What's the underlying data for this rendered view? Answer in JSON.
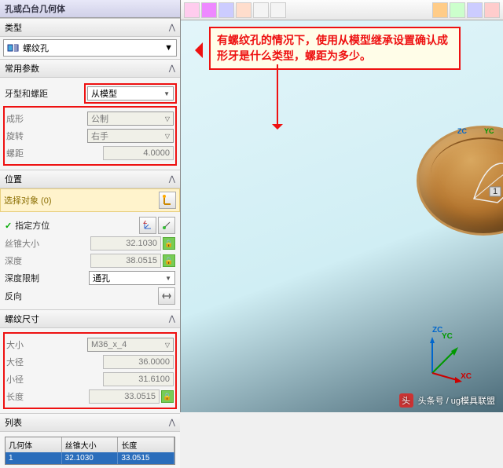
{
  "window_title": "孔或凸台几何体",
  "type_section": {
    "label": "类型",
    "value": "螺纹孔"
  },
  "params_section": {
    "label": "常用参数",
    "thread_type_label": "牙型和螺距",
    "thread_type_value": "从模型",
    "form_label": "成形",
    "form_value": "公制",
    "rotation_label": "旋转",
    "rotation_value": "右手",
    "pitch_label": "螺距",
    "pitch_value": "4.0000"
  },
  "position_section": {
    "label": "位置",
    "select_label": "选择对象 (0)",
    "orient_label": "指定方位",
    "taper_label": "丝锥大小",
    "taper_value": "32.1030",
    "depth_label": "深度",
    "depth_value": "38.0515",
    "depth_limit_label": "深度限制",
    "depth_limit_value": "通孔",
    "reverse_label": "反向"
  },
  "thread_size_section": {
    "label": "螺纹尺寸",
    "size_label": "大小",
    "size_value": "M36_x_4",
    "major_label": "大径",
    "major_value": "36.0000",
    "minor_label": "小径",
    "minor_value": "31.6100",
    "length_label": "长度",
    "length_value": "33.0515"
  },
  "list_section": {
    "label": "列表",
    "headers": [
      "几何体",
      "丝锥大小",
      "长度"
    ],
    "row": [
      "1",
      "32.1030",
      "33.0515"
    ]
  },
  "annotation_text": "有螺纹孔的情况下，使用从模型继承设置确认成形牙是什么类型，螺距为多少。",
  "axes": {
    "xc": "XC",
    "yc": "YC",
    "zc": "ZC"
  },
  "watermark": "头条号 / ug模具联盟"
}
